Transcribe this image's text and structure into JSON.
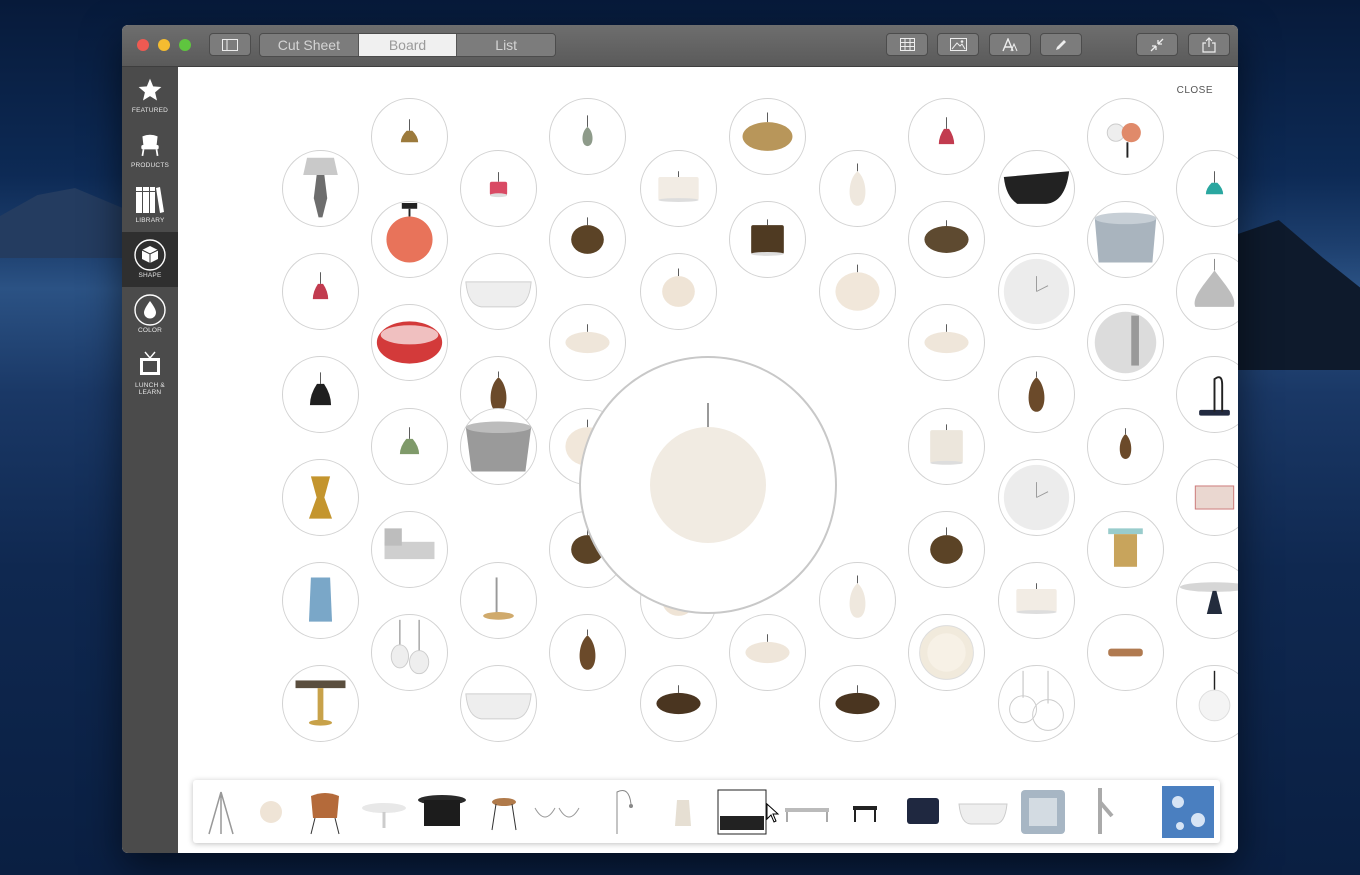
{
  "window": {
    "tabs": [
      {
        "label": "Cut Sheet",
        "active": false
      },
      {
        "label": "Board",
        "active": true
      },
      {
        "label": "List",
        "active": false
      }
    ],
    "toolbar_icons": [
      "sidebar-toggle-icon",
      "grid-icon",
      "image-icon",
      "text-style-icon",
      "pencil-icon",
      "collapse-icon",
      "share-icon"
    ]
  },
  "sidebar": {
    "items": [
      {
        "label": "FEATURED",
        "icon": "star-icon"
      },
      {
        "label": "PRODUCTS",
        "icon": "chair-icon"
      },
      {
        "label": "LIBRARY",
        "icon": "books-icon"
      },
      {
        "label": "SHAPE",
        "icon": "cube-icon",
        "active": true
      },
      {
        "label": "COLOR",
        "icon": "drop-icon"
      },
      {
        "label": "LUNCH & LEARN",
        "icon": "tv-icon"
      }
    ]
  },
  "board": {
    "close_label": "CLOSE",
    "featured_product": "white-sphere-pendant",
    "products": [
      "brown-pendant",
      "grey-glass-pendant",
      "brass-dome-pendant",
      "red-pendant",
      "globe-pendant-copper",
      "grey-table-lamp",
      "red-cage-pendant",
      "drum-pendant",
      "white-bud-pendant",
      "black-bathtub",
      "teal-pendant",
      "orange-globe-pendant",
      "wood-globe-pendant",
      "brown-wood-pendant",
      "brown-dome-pendant",
      "woven-basket",
      "red-pendant",
      "white-bathtub",
      "small-white-sphere",
      "white-sphere",
      "white-wall-clock",
      "chrome-teardrop",
      "red-check-pouf",
      "oval-white-pendant",
      "oval-white-pendant",
      "round-mirror",
      "black-cone-pendant",
      "wood-bud-pendant",
      "wood-bud-pendant",
      "blue-side-lamp",
      "green-pendant",
      "woven-grey-basket",
      "white-sphere",
      "white-cylinder-pendant",
      "wood-bud-small",
      "brass-hourglass",
      "white-wall-clock",
      "marble-box",
      "patterned-chaise",
      "wood-globe-pendant",
      "wood-globe-pendant",
      "glass-side-table",
      "decorative-vase",
      "brass-side-table",
      "small-white-sphere",
      "white-bud-pendant",
      "drum-pendant",
      "black-pedestal-table",
      "multi-pendant-cluster",
      "wood-bud-pendant",
      "oval-white-pendant",
      "white-dish",
      "wood-flush-mount",
      "brass-bistro-table",
      "white-bathtub",
      "oval-wood-pendant",
      "oval-wood-pendant",
      "glass-cluster-pendant",
      "white-globe-pendant"
    ]
  },
  "tray": {
    "items": [
      "tripod-floor-lamp",
      "white-sphere-pendant",
      "orange-armchair",
      "white-round-table",
      "black-drum-table",
      "wood-stool",
      "wire-bowls",
      "arc-floor-lamp",
      "ceramic-vase",
      "canopy-bed",
      "glass-coffee-table",
      "black-side-table",
      "blue-lounge-chair",
      "white-bathtub",
      "patterned-pillow",
      "chrome-faucet",
      "blue-floral-fabric"
    ]
  },
  "colors": {
    "titlebar": "#626262",
    "sidebar": "#4b4b4b",
    "sidebar_active": "#2f2f2f",
    "bubble_border": "#d2d2d2",
    "traffic_red": "#ee5a52",
    "traffic_yellow": "#f4bc30",
    "traffic_green": "#5fc53f"
  }
}
